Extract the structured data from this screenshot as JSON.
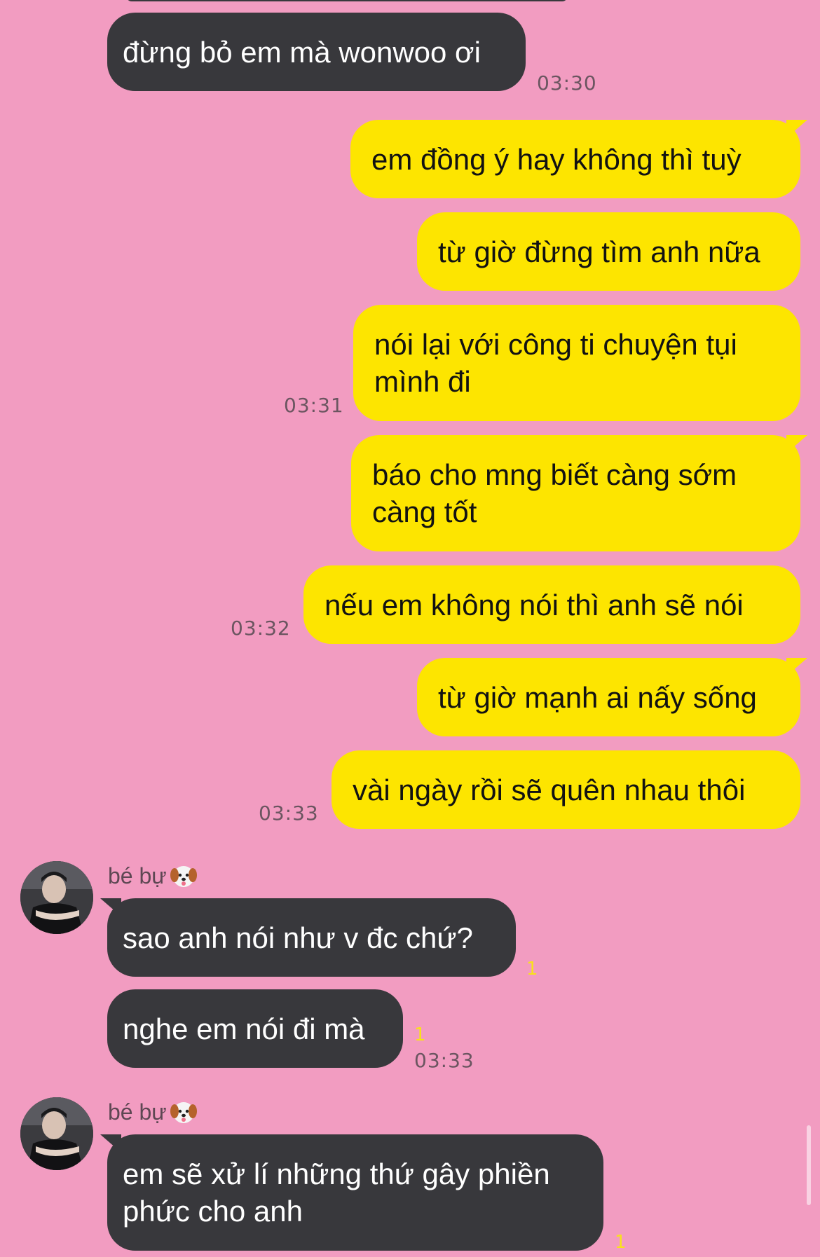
{
  "messages": {
    "m1": {
      "text": "đừng bỏ em mà wonwoo ơi",
      "time": "03:30"
    },
    "m2": {
      "text": "em đồng ý hay không thì tuỳ"
    },
    "m3": {
      "text": "từ giờ đừng tìm anh nữa"
    },
    "m4": {
      "line1": "nói lại với công ti chuyện tụi",
      "line2": "mình đi",
      "time": "03:31"
    },
    "m5": {
      "line1": "báo cho mng biết càng sớm",
      "line2": "càng tốt"
    },
    "m6": {
      "text": "nếu em không nói thì anh sẽ nói",
      "time": "03:32"
    },
    "m7": {
      "text": "từ giờ mạnh ai nấy sống"
    },
    "m8": {
      "text": "vài ngày rồi sẽ quên nhau thôi",
      "time": "03:33"
    },
    "m9": {
      "sender": "bé bự",
      "text": "sao anh nói như v đc chứ?",
      "unread": "1"
    },
    "m10": {
      "text": "nghe em nói đi mà",
      "unread": "1",
      "time": "03:33"
    },
    "m11": {
      "sender": "bé bự",
      "line1": "em sẽ xử lí những thứ gây phiền",
      "line2": "phức cho anh",
      "unread": "1"
    }
  },
  "icons": {
    "sender_emoji": "dog-face-icon",
    "avatar": "contact-avatar"
  },
  "colors": {
    "background": "#f29cc1",
    "incoming_bubble": "#38383c",
    "outgoing_bubble": "#fde500",
    "unread_count": "#f8e21a"
  }
}
